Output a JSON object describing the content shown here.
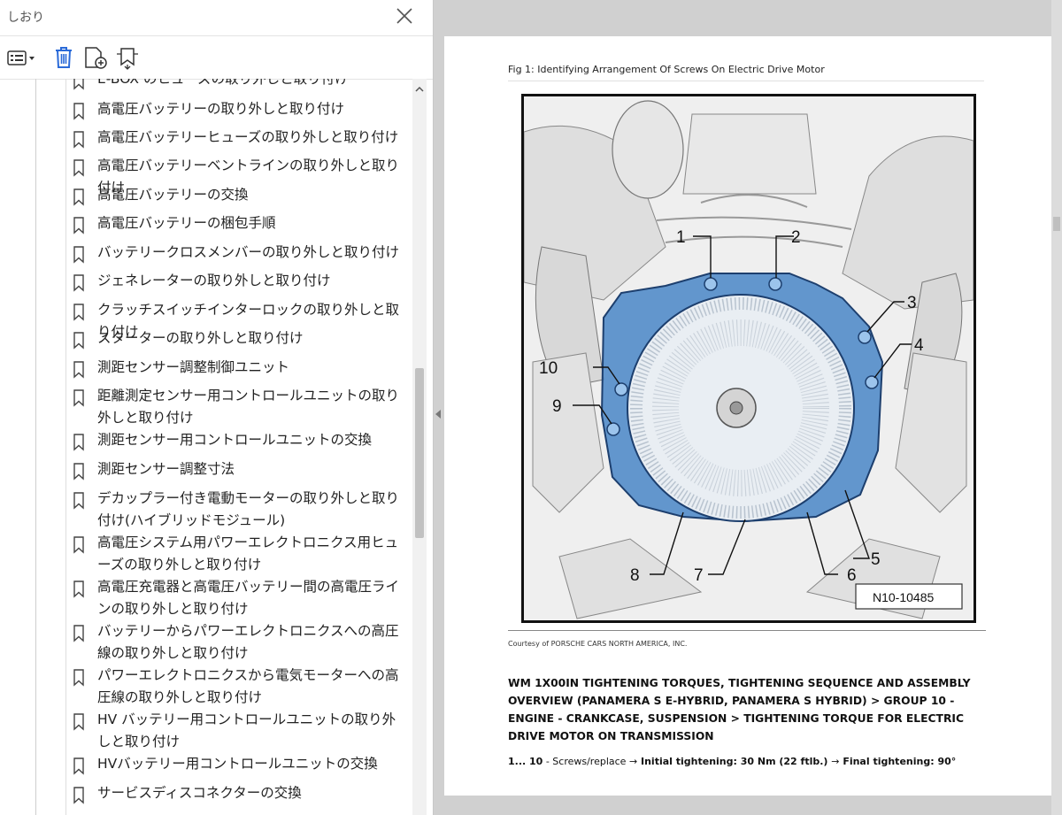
{
  "sidebar": {
    "title": "しおり",
    "partial_item": "E-BOX のヒューズの取り外しと取り付け",
    "items": [
      {
        "label": "高電圧バッテリーの取り外しと取り付け"
      },
      {
        "label": "高電圧バッテリーヒューズの取り外しと取り付け"
      },
      {
        "label": "高電圧バッテリーベントラインの取り外しと取り付け"
      },
      {
        "label": "高電圧バッテリーの交換"
      },
      {
        "label": "高電圧バッテリーの梱包手順"
      },
      {
        "label": "バッテリークロスメンバーの取り外しと取り付け"
      },
      {
        "label": "ジェネレーターの取り外しと取り付け"
      },
      {
        "label": "クラッチスイッチインターロックの取り外しと取り付け"
      },
      {
        "label": "スターターの取り外しと取り付け"
      },
      {
        "label": "測距センサー調整制御ユニット"
      },
      {
        "label": "距離測定センサー用コントロールユニットの取り外しと取り付け"
      },
      {
        "label": "測距センサー用コントロールユニットの交換"
      },
      {
        "label": "測距センサー調整寸法"
      },
      {
        "label": "デカップラー付き電動モーターの取り外しと取り付け(ハイブリッドモジュール)"
      },
      {
        "label": "高電圧システム用パワーエレクトロニクス用ヒューズの取り外しと取り付け"
      },
      {
        "label": "高電圧充電器と高電圧バッテリー間の高電圧ラインの取り外しと取り付け"
      },
      {
        "label": "バッテリーからパワーエレクトロニクスへの高圧線の取り外しと取り付け"
      },
      {
        "label": "パワーエレクトロニクスから電気モーターへの高圧線の取り外しと取り付け"
      },
      {
        "label": "HV バッテリー用コントロールユニットの取り外しと取り付け"
      },
      {
        "label": "HVバッテリー用コントロールユニットの交換"
      },
      {
        "label": "サービスディスコネクターの交換"
      }
    ]
  },
  "document": {
    "figure_caption": "Fig 1: Identifying Arrangement Of Screws On Electric Drive Motor",
    "figure_code": "N10-10485",
    "callouts": [
      "1",
      "2",
      "3",
      "4",
      "5",
      "6",
      "7",
      "8",
      "9",
      "10"
    ],
    "courtesy": "Courtesy of PORSCHE CARS NORTH AMERICA, INC.",
    "heading": "WM 1X00IN TIGHTENING TORQUES, TIGHTENING SEQUENCE AND ASSEMBLY OVERVIEW (PANAMERA S E-HYBRID, PANAMERA S HYBRID) > GROUP 10 - ENGINE - CRANKCASE, SUSPENSION > TIGHTENING TORQUE FOR ELECTRIC DRIVE MOTOR ON TRANSMISSION",
    "spec_items": "1... 10",
    "spec_part": " - Screws/replace ",
    "spec_arrow1": "→",
    "spec_initial": " Initial tightening: 30 Nm (22 ftlb.) ",
    "spec_arrow2": "→",
    "spec_final": " Final tightening: 90°"
  },
  "icons": {
    "close": "close-icon",
    "options": "options-menu-icon",
    "delete": "trash-icon",
    "new_bookmark": "new-bookmark-icon",
    "expand": "expand-bookmark-icon",
    "bookmark": "bookmark-icon"
  },
  "colors": {
    "accent": "#2a6ad8",
    "housing": "#3f7fc4"
  }
}
